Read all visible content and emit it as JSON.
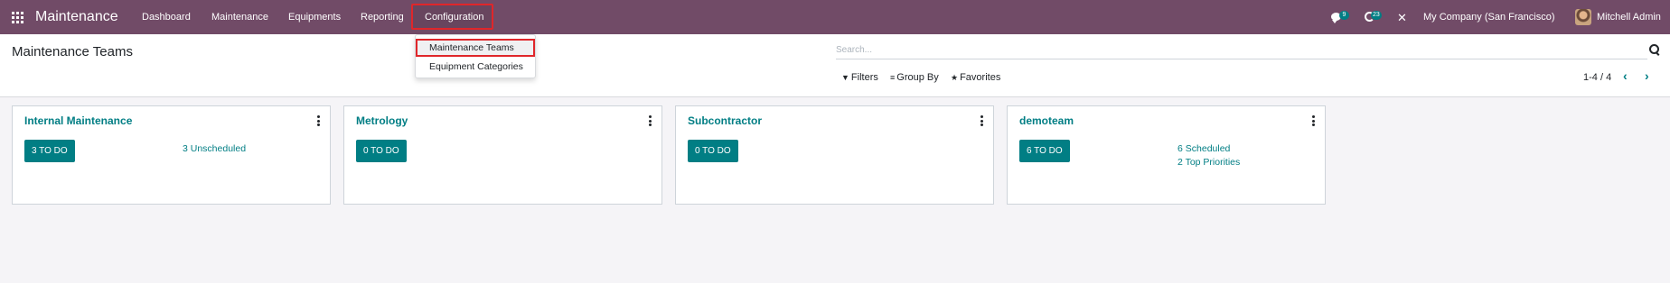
{
  "navbar": {
    "brand": "Maintenance",
    "menu": [
      "Dashboard",
      "Maintenance",
      "Equipments",
      "Reporting",
      "Configuration"
    ],
    "messages_badge": "9",
    "activities_badge": "23",
    "company": "My Company (San Francisco)",
    "user": "Mitchell Admin",
    "icons": [
      "apps-icon",
      "chat-icon",
      "clock-icon",
      "tools-icon"
    ]
  },
  "dropdown": {
    "items": [
      "Maintenance Teams",
      "Equipment Categories"
    ]
  },
  "control_panel": {
    "title": "Maintenance Teams",
    "search_placeholder": "Search...",
    "filters_label": "Filters",
    "groupby_label": "Group By",
    "favorites_label": "Favorites",
    "pager": "1-4 / 4"
  },
  "teams": [
    {
      "name": "Internal Maintenance",
      "todo": "3 TO DO",
      "links": [
        "3 Unscheduled"
      ]
    },
    {
      "name": "Metrology",
      "todo": "0 TO DO",
      "links": []
    },
    {
      "name": "Subcontractor",
      "todo": "0 TO DO",
      "links": []
    },
    {
      "name": "demoteam",
      "todo": "6 TO DO",
      "links": [
        "6 Scheduled",
        "2 Top Priorities"
      ]
    }
  ],
  "colors": {
    "navbar": "#714b67",
    "accent": "#017e84",
    "highlight_box": "#e0262a"
  }
}
